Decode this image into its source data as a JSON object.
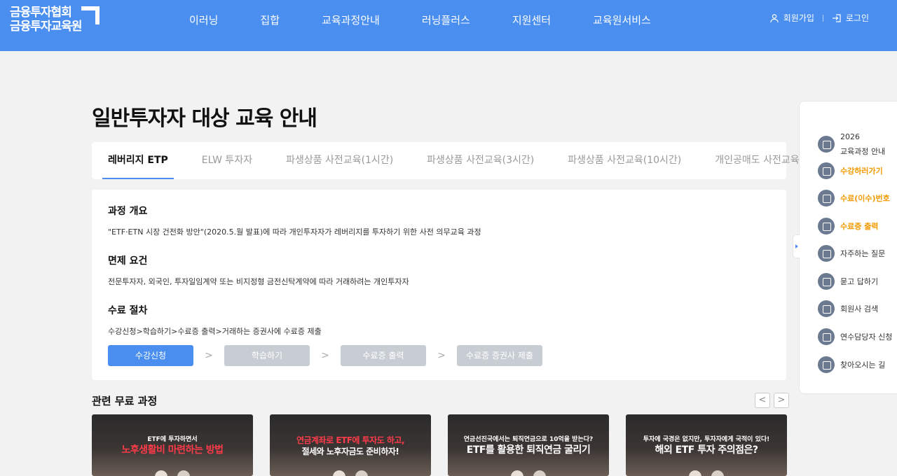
{
  "brand": {
    "line1": "금융투자협회",
    "line2": "금융투자교육원"
  },
  "nav": [
    "이러닝",
    "집합",
    "교육과정안내",
    "러닝플러스",
    "지원센터",
    "교육원서비스"
  ],
  "util": {
    "signup": "회원가입",
    "login": "로그인"
  },
  "page_title": "일반투자자 대상 교육 안내",
  "tabs": [
    "레버리지 ETP",
    "ELW 투자자",
    "파생상품 사전교육(1시간)",
    "파생상품 사전교육(3시간)",
    "파생상품 사전교육(10시간)",
    "개인공매도 사전교육"
  ],
  "sections": {
    "overview_title": "과정 개요",
    "overview_text": "\"ETF·ETN 시장 건전화 방안\"(2020.5.월 발표)에 따라 개인투자자가 레버리지를 투자하기 위한 사전 의무교육 과정",
    "exempt_title": "면제 요건",
    "exempt_text": "전문투자자, 외국인, 투자일임계약 또는 비지정형 금전신탁계약에 따라 거래하려는 개인투자자",
    "process_title": "수료 절차",
    "process_text": "수강신청>학습하기>수료증 출력>거래하는 증권사에 수료증 제출"
  },
  "steps": [
    "수강신청",
    "학습하기",
    "수료증 출력",
    "수료증 증권사 제출"
  ],
  "related": {
    "title": "관련 무료 과정",
    "prev": "<",
    "next": ">",
    "items": [
      {
        "top": "ETF에 투자하면서",
        "main": "노후생활비 마련하는 방법"
      },
      {
        "red": "연금계좌로 ETF에 투자도 하고,",
        "white": "절세와 노후자금도 준비하자!"
      },
      {
        "top": "연금선진국에서는 퇴직연금으로 10억을 받는다?",
        "main": "ETF를 활용한 퇴직연금 굴리기"
      },
      {
        "top": "투자에 국경은 없지만, 투자자에게 국적이 있다!",
        "main": "해외 ETF 투자 주의점은?"
      }
    ]
  },
  "quick_menu": {
    "item0_line1": "2026",
    "item0_line2": "교육과정 안내",
    "items": [
      "수강하러가기",
      "수료(이수)번호",
      "수료증 출력",
      "자주하는 질문",
      "묻고 답하기",
      "회원사 검색",
      "연수담당자 신청",
      "찾아오시는 길"
    ]
  },
  "colors": {
    "primary": "#4a8ff0",
    "highlight": "#f39a00",
    "thumb_accent": "#ff3b4a"
  }
}
